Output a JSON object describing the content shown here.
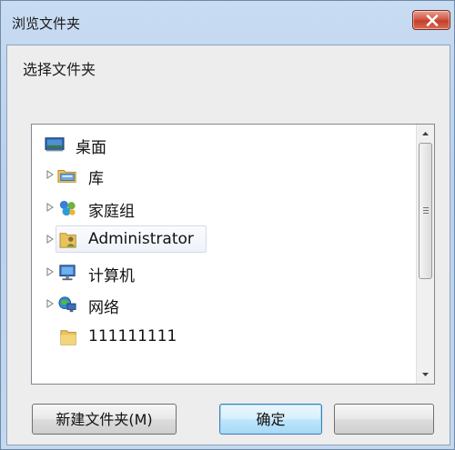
{
  "window": {
    "title": "浏览文件夹"
  },
  "dialog": {
    "prompt": "选择文件夹"
  },
  "tree": {
    "items": [
      {
        "label": "桌面",
        "icon": "desktop-icon",
        "expandable": false
      },
      {
        "label": "库",
        "icon": "library-folder-icon",
        "expandable": true
      },
      {
        "label": "家庭组",
        "icon": "homegroup-icon",
        "expandable": true
      },
      {
        "label": "Administrator",
        "icon": "user-folder-icon",
        "expandable": true,
        "hovered": true
      },
      {
        "label": "计算机",
        "icon": "computer-icon",
        "expandable": true
      },
      {
        "label": "网络",
        "icon": "network-icon",
        "expandable": true
      },
      {
        "label": "111111111",
        "icon": "folder-icon",
        "expandable": false
      }
    ]
  },
  "buttons": {
    "new_folder": "新建文件夹(M)",
    "ok": "确定",
    "cancel": ""
  },
  "colors": {
    "title_bar": "#c8dcf2",
    "close_button": "#c2402b",
    "ok_button_border": "#3c7fb1"
  }
}
